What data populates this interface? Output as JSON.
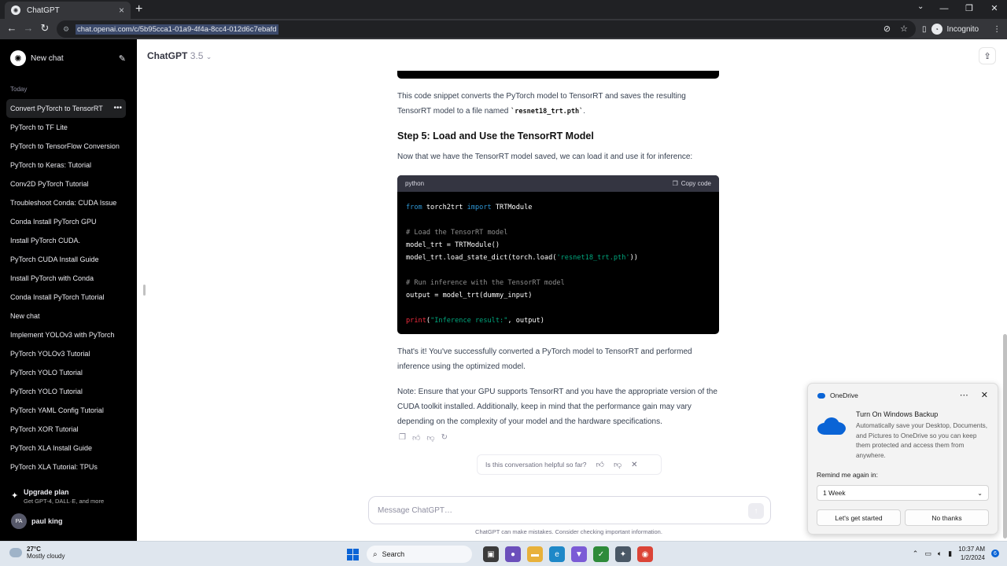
{
  "browser": {
    "tab_title": "ChatGPT",
    "tab_close": "×",
    "new_tab": "+",
    "url": "chat.openai.com/c/5b95cca1-01a9-4f4a-8cc4-012d6c7ebafd",
    "incognito_label": "Incognito"
  },
  "sidebar": {
    "new_chat_label": "New chat",
    "section_label": "Today",
    "items": [
      {
        "label": "Convert PyTorch to TensorRT"
      },
      {
        "label": "PyTorch to TF Lite"
      },
      {
        "label": "PyTorch to TensorFlow Conversion"
      },
      {
        "label": "PyTorch to Keras: Tutorial"
      },
      {
        "label": "Conv2D PyTorch Tutorial"
      },
      {
        "label": "Troubleshoot Conda: CUDA Issue"
      },
      {
        "label": "Conda Install PyTorch GPU"
      },
      {
        "label": "Install PyTorch CUDA."
      },
      {
        "label": "PyTorch CUDA Install Guide"
      },
      {
        "label": "Install PyTorch with Conda"
      },
      {
        "label": "Conda Install PyTorch Tutorial"
      },
      {
        "label": "New chat"
      },
      {
        "label": "Implement YOLOv3 with PyTorch"
      },
      {
        "label": "PyTorch YOLOv3 Tutorial"
      },
      {
        "label": "PyTorch YOLO Tutorial"
      },
      {
        "label": "PyTorch YOLO Tutorial"
      },
      {
        "label": "PyTorch YAML Config Tutorial"
      },
      {
        "label": "PyTorch XOR Tutorial"
      },
      {
        "label": "PyTorch XLA Install Guide"
      },
      {
        "label": "PyTorch XLA Tutorial: TPUs"
      }
    ],
    "active_index": 0,
    "upgrade_title": "Upgrade plan",
    "upgrade_sub": "Get GPT-4, DALL·E, and more",
    "user_initials": "PA",
    "user_name": "paul king"
  },
  "main": {
    "model_name": "ChatGPT",
    "model_version": "3.5",
    "para1_a": "This code snippet converts the PyTorch model to TensorRT and saves the resulting TensorRT model to a file named ",
    "para1_code": "`resnet18_trt.pth`",
    "para1_b": ".",
    "heading": "Step 5: Load and Use the TensorRT Model",
    "para2": "Now that we have the TensorRT model saved, we can load it and use it for inference:",
    "code_lang": "python",
    "copy_label": "Copy code",
    "code": {
      "l1_kw1": "from",
      "l1_mid": " torch2trt ",
      "l1_kw2": "import",
      "l1_end": " TRTModule",
      "l2": "# Load the TensorRT model",
      "l3": "model_trt = TRTModule()",
      "l4_a": "model_trt.load_state_dict(torch.load(",
      "l4_str": "'resnet18_trt.pth'",
      "l4_b": "))",
      "l5": "# Run inference with the TensorRT model",
      "l6": "output = model_trt(dummy_input)",
      "l7_fn": "print",
      "l7_a": "(",
      "l7_str": "\"Inference result:\"",
      "l7_b": ", output)"
    },
    "para3": "That's it! You've successfully converted a PyTorch model to TensorRT and performed inference using the optimized model.",
    "para4": "Note: Ensure that your GPU supports TensorRT and you have the appropriate version of the CUDA toolkit installed. Additionally, keep in mind that the performance gain may vary depending on the complexity of your model and the hardware specifications.",
    "helpful_text": "Is this conversation helpful so far?",
    "composer_placeholder": "Message ChatGPT…",
    "disclaimer": "ChatGPT can make mistakes. Consider checking important information."
  },
  "toast": {
    "app": "OneDrive",
    "title": "Turn On Windows Backup",
    "body": "Automatically save your Desktop, Documents, and Pictures to OneDrive so you can keep them protected and access them from anywhere.",
    "remind_label": "Remind me again in:",
    "remind_value": "1 Week",
    "primary_button": "Let's get started",
    "secondary_button": "No thanks"
  },
  "taskbar": {
    "temperature": "27°C",
    "weather": "Mostly cloudy",
    "search_label": "Search",
    "time": "10:37 AM",
    "date": "1/2/2024",
    "notifications": "6"
  },
  "colors": {
    "sidebar_bg": "#000000",
    "accent": "#0a64d6",
    "code_keyword": "#2e95d3",
    "code_string": "#00a67d"
  }
}
